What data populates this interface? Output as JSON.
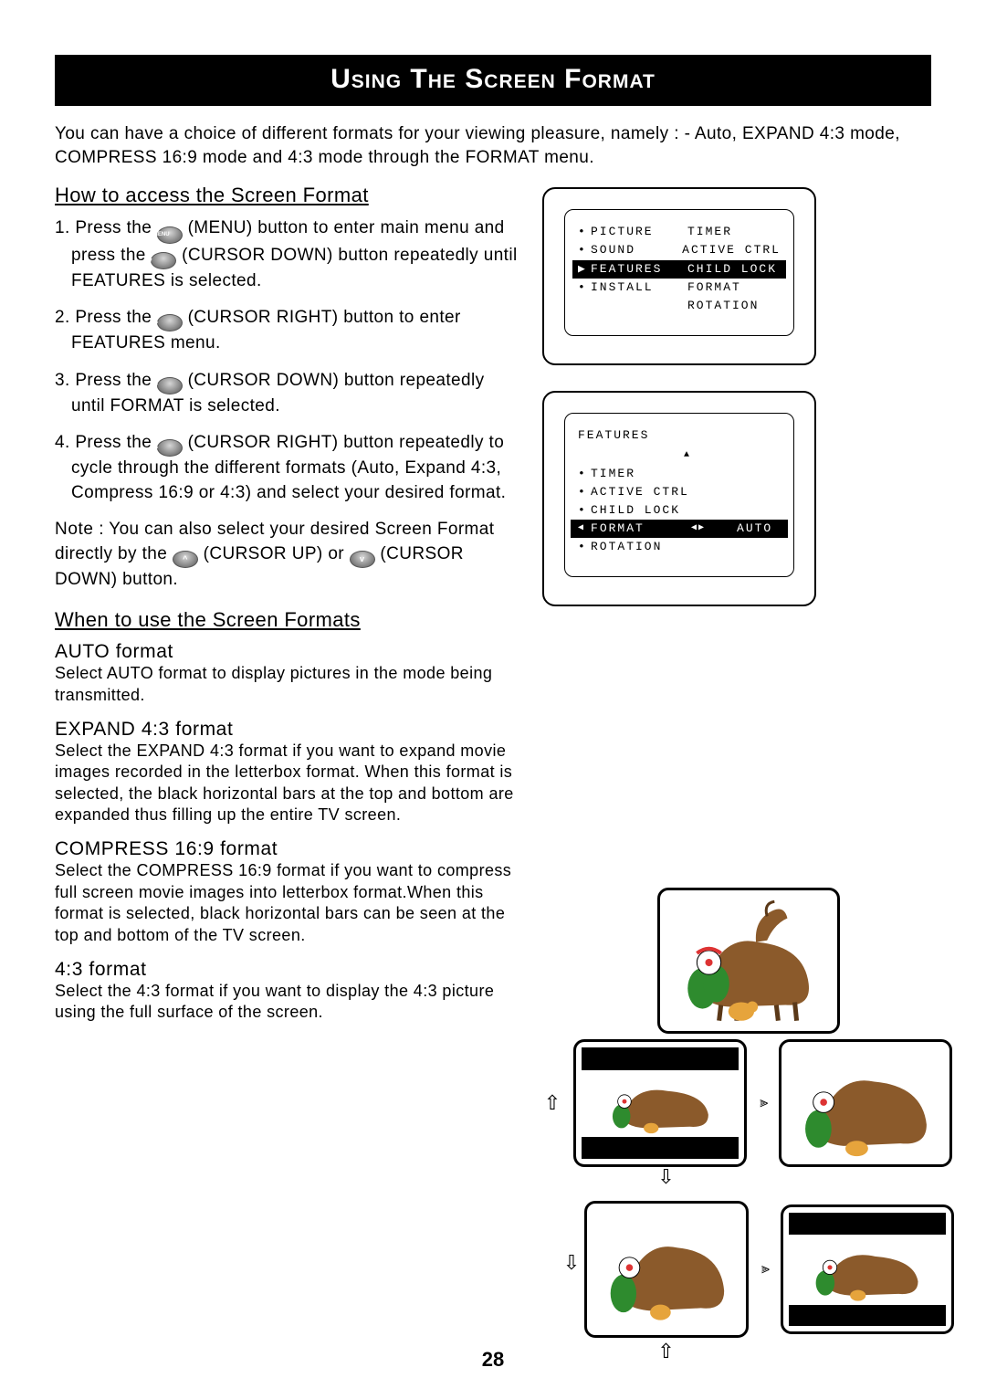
{
  "title": "Using The Screen Format",
  "intro": "You can have a choice of different formats for your viewing pleasure, namely : - Auto, EXPAND 4:3 mode, COMPRESS 16:9 mode and 4:3 mode through the FORMAT menu.",
  "section1_head": "How to access the Screen Format",
  "step1_a": "1. Press the ",
  "step1_b": " (MENU) button to enter main menu and press the ",
  "step1_c": " (CURSOR DOWN) button repeatedly until FEATURES is selected.",
  "step2_a": "2. Press the ",
  "step2_b": " (CURSOR RIGHT) button to enter FEATURES menu.",
  "step3_a": "3. Press the ",
  "step3_b": " (CURSOR DOWN) button repeatedly until FORMAT is selected.",
  "step4_a": "4. Press the ",
  "step4_b": " (CURSOR RIGHT) button repeatedly to cycle through the different formats (Auto, Expand 4:3, Compress 16:9 or 4:3) and select your desired format.",
  "note_label": "Note",
  "note_a": " : You can also select your desired Screen Format directly by the ",
  "note_b": " (CURSOR UP) or ",
  "note_c": " (CURSOR DOWN) button.",
  "section2_head": "When to use the Screen Formats",
  "auto_head": "AUTO format",
  "auto_body": "Select AUTO format to display pictures in the mode being transmitted.",
  "expand_head": "EXPAND 4:3 format",
  "expand_body": "Select the EXPAND 4:3 format if you want to expand movie images recorded in the letterbox format. When this format is selected, the black horizontal bars at the top and bottom are expanded thus filling up the entire TV screen.",
  "compress_head": "COMPRESS 16:9 format",
  "compress_body": "Select the COMPRESS 16:9 format if you want to compress full screen movie images into letterbox format.When this format is selected, black horizontal bars can be seen at the top and bottom of the TV screen.",
  "f43_head": "4:3 format",
  "f43_body": "Select the 4:3 format if you want to display the 4:3 picture using the full surface of the screen.",
  "osd1": {
    "left": [
      "PICTURE",
      "SOUND",
      "FEATURES",
      "INSTALL"
    ],
    "right": [
      "TIMER",
      "ACTIVE CTRL",
      "CHILD LOCK",
      "FORMAT",
      "ROTATION"
    ],
    "selected_index": 2
  },
  "osd2": {
    "title": "FEATURES",
    "items": [
      "TIMER",
      "ACTIVE CTRL",
      "CHILD LOCK",
      "FORMAT",
      "ROTATION"
    ],
    "selected_index": 3,
    "selected_value": "AUTO"
  },
  "icon_labels": {
    "menu": "MENU",
    "down": "v",
    "right": ">",
    "up": "^"
  },
  "page_number": "28"
}
